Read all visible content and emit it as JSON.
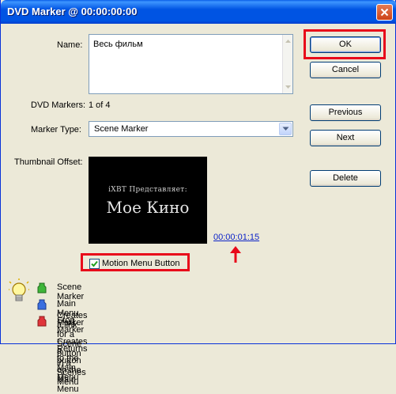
{
  "window": {
    "title": "DVD Marker @ 00:00:00:00"
  },
  "fields": {
    "name_label": "Name:",
    "name_value": "Весь фильм",
    "dvd_markers_label": "DVD Markers:",
    "dvd_markers_value": "1 of 4",
    "marker_type_label": "Marker Type:",
    "marker_type_value": "Scene Marker",
    "thumbnail_offset_label": "Thumbnail Offset:"
  },
  "thumbnail": {
    "line1": "iXBT Представляет:",
    "line2": "Мое Кино",
    "timecode": "00:00:01:15"
  },
  "buttons": {
    "ok": "OK",
    "cancel": "Cancel",
    "previous": "Previous",
    "next": "Next",
    "delete": "Delete"
  },
  "checkbox": {
    "label": "Motion Menu Button",
    "checked": true
  },
  "legend": [
    {
      "text": "Scene Marker - Creates a link for a Scene button in a Scenes Menu",
      "color": "#3fb63a"
    },
    {
      "text": "Main Menu Marker - Creates a button on the Main Menu",
      "color": "#3a6fe0"
    },
    {
      "text": "Stop Marker - Returns to the Main Menu",
      "color": "#e0343a"
    }
  ],
  "colors": {
    "highlight": "#e8081a",
    "link": "#0b22c8",
    "titlebar": "#0054e3"
  }
}
